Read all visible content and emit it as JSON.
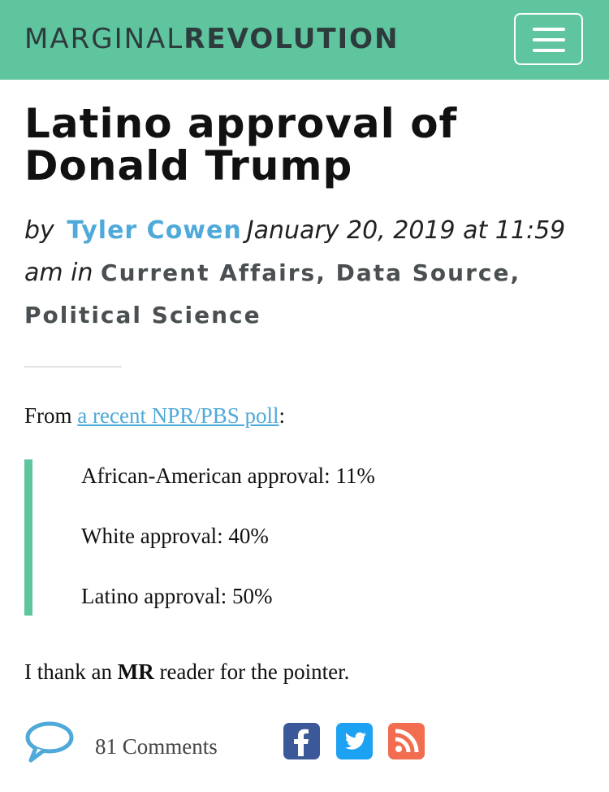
{
  "header": {
    "logo_thin": "MARGINAL",
    "logo_bold": "REVOLUTION",
    "menu_icon": "hamburger-menu-icon",
    "colors": {
      "bar": "#5ec59f",
      "logo_text": "#2d3b3c"
    }
  },
  "post": {
    "title": "Latino approval of Donald Trump",
    "by_label": "by",
    "author": "Tyler Cowen",
    "date": "January 20, 2019 at 11:59 am in",
    "categories": "Current Affairs, Data Source, Political Science",
    "from_label": "From",
    "link_text": "a recent NPR/PBS poll",
    "link_suffix": ":",
    "quote": [
      "African-American approval: 11%",
      "White approval: 40%",
      "Latino approval: 50%"
    ],
    "thanks_pre": "I thank an",
    "thanks_bold": "MR",
    "thanks_post": "reader for the pointer.",
    "link_color": "#4fa9d9"
  },
  "footer": {
    "comments": "81 Comments",
    "comment_icon": "speech-bubble-icon",
    "share_icons": [
      "facebook-icon",
      "twitter-icon",
      "rss-icon"
    ]
  }
}
